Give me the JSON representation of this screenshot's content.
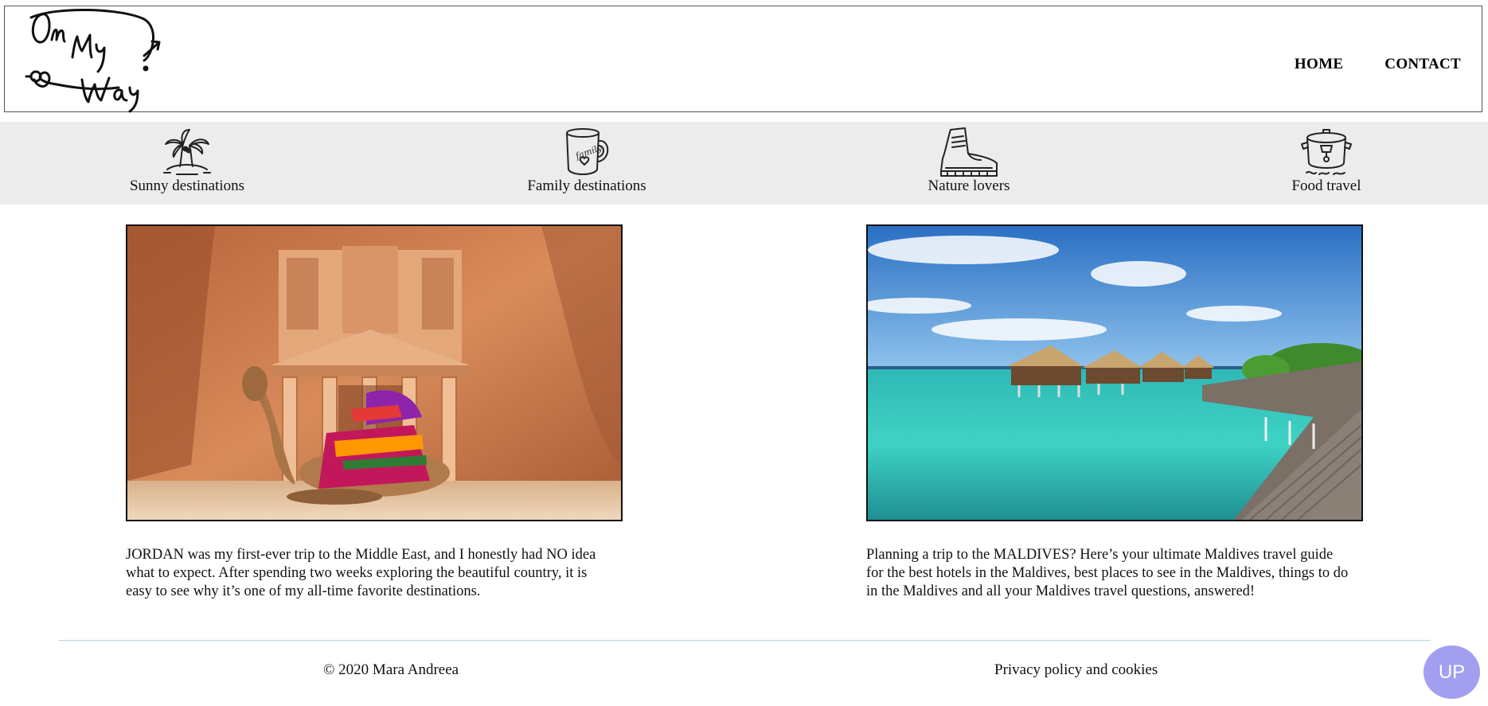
{
  "header": {
    "logo_text": "On My Way",
    "nav": [
      {
        "label": "HOME"
      },
      {
        "label": "CONTACT"
      }
    ]
  },
  "categories": [
    {
      "label": "Sunny destinations",
      "icon": "palm-island-icon"
    },
    {
      "label": "Family destinations",
      "icon": "family-mug-icon",
      "icon_text": "family"
    },
    {
      "label": "Nature lovers",
      "icon": "hiking-boot-icon"
    },
    {
      "label": "Food travel",
      "icon": "cooking-pot-icon"
    }
  ],
  "posts": [
    {
      "image": "petra-treasury-camel-photo",
      "text": "JORDAN was my first-ever trip to the Middle East, and I honestly had NO idea what to expect. After spending two weeks exploring the beautiful country, it is easy to see why it’s one of my all-time favorite destinations."
    },
    {
      "image": "maldives-overwater-bungalows-photo",
      "text": "Planning a trip to the MALDIVES? Here’s your ultimate Maldives travel guide for the best hotels in the Maldives, best places to see in the Maldives, things to do in the Maldives and all your Maldives travel questions, answered!"
    }
  ],
  "footer": {
    "copyright": "© 2020 Mara Andreea",
    "privacy": "Privacy policy and cookies",
    "up_label": "UP"
  },
  "colors": {
    "category_bar": "#ececec",
    "footer_line": "#a9d6db",
    "up_button": "#a29ff0"
  }
}
